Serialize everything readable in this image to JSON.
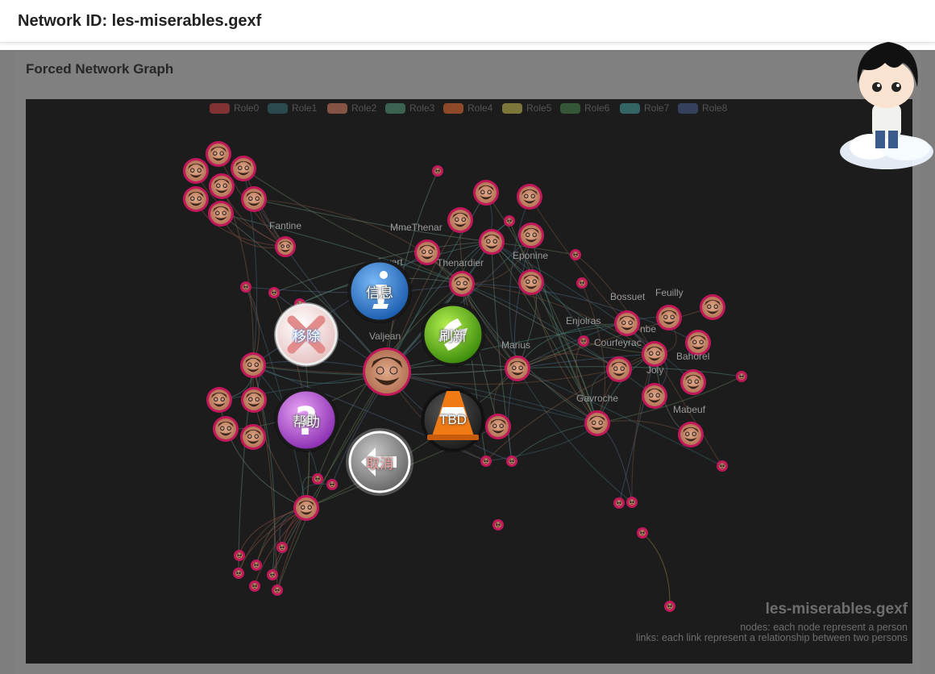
{
  "header": {
    "title": "Network ID: les-miserables.gexf"
  },
  "panel": {
    "title": "Forced Network Graph"
  },
  "legend": [
    "Role0",
    "Role1",
    "Role2",
    "Role3",
    "Role4",
    "Role5",
    "Role6",
    "Role7",
    "Role8"
  ],
  "legend_colors": [
    "#a33a3a",
    "#2f5a60",
    "#a86650",
    "#477a63",
    "#b4582e",
    "#9e9445",
    "#3d6b40",
    "#3b7d7e",
    "#3e4d72"
  ],
  "node_labels": {
    "fantine": "Fantine",
    "mmethenardier": "MmeThenar",
    "javert": "Javert",
    "thenardier": "Thenardier",
    "eponine": "Eponine",
    "valjean": "Valjean",
    "marius": "Marius",
    "bossuet": "Bossuet",
    "feuilly": "Feuilly",
    "enjolras": "Enjolras",
    "combeferre": "nbe",
    "courfeyrac": "Courfeyrac",
    "bahorel": "Bahorel",
    "joly": "Joly",
    "gavroche": "Gavroche",
    "mabeuf": "Mabeuf"
  },
  "menu": {
    "info": "信息",
    "refresh": "刷新",
    "remove": "移除",
    "tbd": "TBD",
    "help": "帮助",
    "cancel": "取消"
  },
  "menu_icons": {
    "info": "info-icon",
    "refresh": "phone-refresh-icon",
    "remove": "close-icon",
    "tbd": "traffic-cone-icon",
    "help": "question-icon",
    "cancel": "back-arrow-icon"
  },
  "caption": {
    "title": "les-miserables.gexf",
    "nodes": "nodes: each node represent a person",
    "links": "links: each link represent a relationship between two persons"
  },
  "colors": {
    "node_ring": "#c2185b",
    "graph_bg": "#1c1c1c",
    "overlay": "#808080"
  }
}
